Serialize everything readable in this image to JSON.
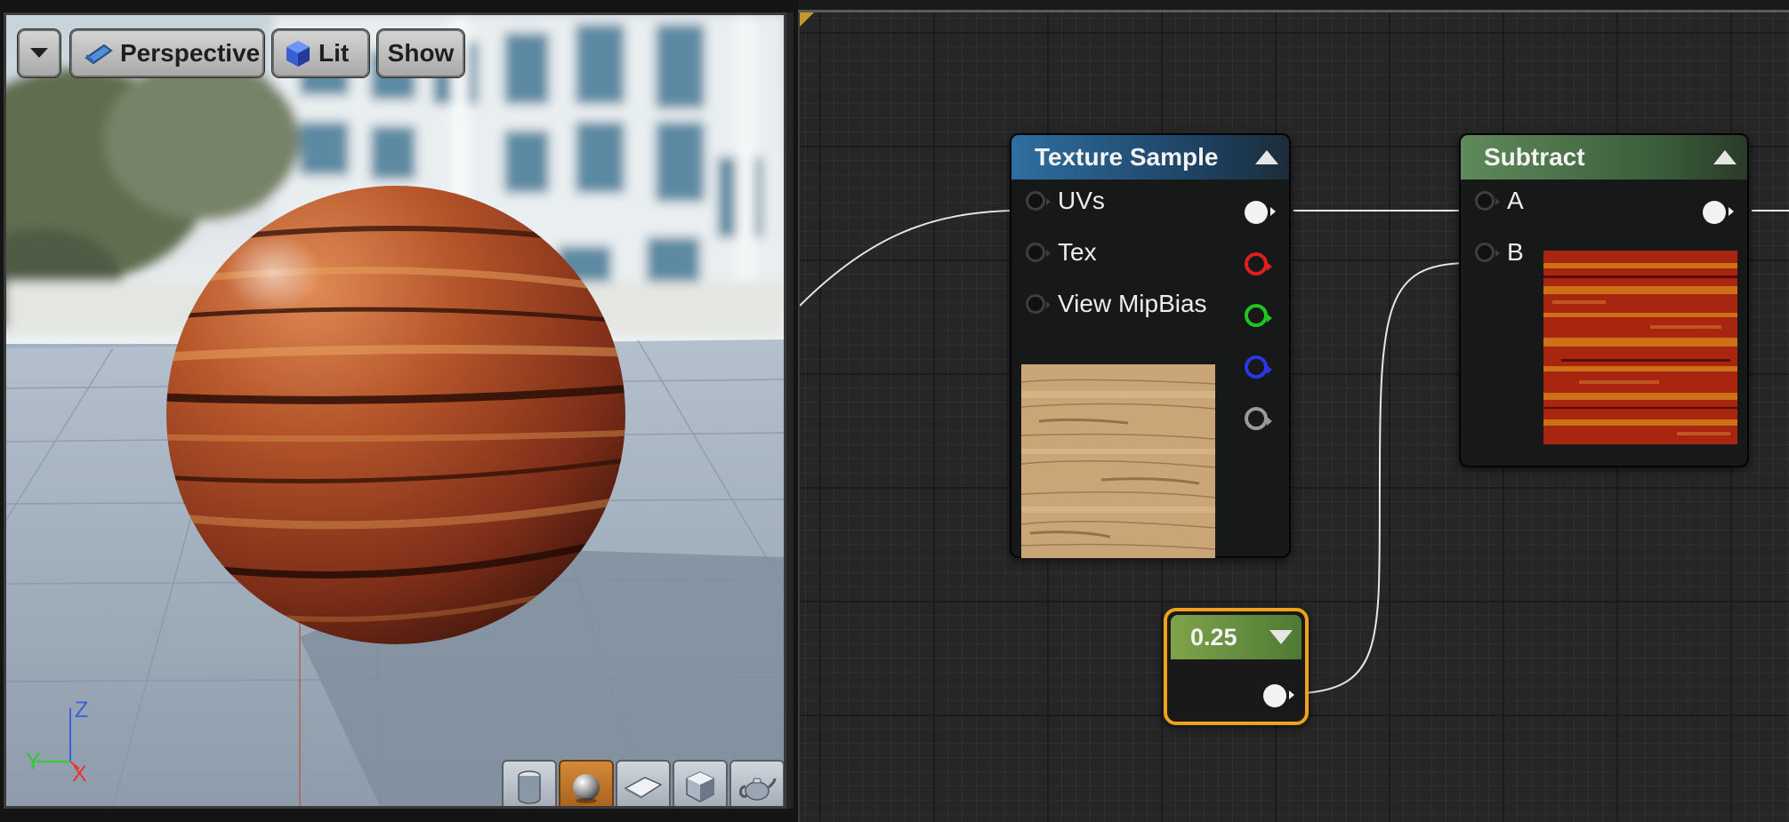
{
  "viewport": {
    "toolbar": {
      "perspective_label": "Perspective",
      "lit_label": "Lit",
      "show_label": "Show"
    },
    "axis_labels": {
      "z": "Z",
      "y": "Y",
      "x": "X"
    },
    "preview_shapes": [
      "cylinder-icon",
      "sphere-icon",
      "plane-icon",
      "cube-icon",
      "teapot-icon"
    ],
    "active_preview": "sphere-icon"
  },
  "graph": {
    "texture_sample": {
      "title": "Texture Sample",
      "inputs": [
        "UVs",
        "Tex",
        "View MipBias"
      ],
      "output_colors": [
        "#f2f2f2",
        "#e02020",
        "#21c421",
        "#2b36e6",
        "#9a9a9a"
      ]
    },
    "subtract": {
      "title": "Subtract",
      "inputs": [
        "A",
        "B"
      ]
    },
    "constant": {
      "value": "0.25"
    },
    "colors": {
      "selection": "#f0a11a",
      "texture_header": "#2e6ea0",
      "subtract_header": "#5f8a5c",
      "constant_header": "#7fa34b"
    }
  }
}
